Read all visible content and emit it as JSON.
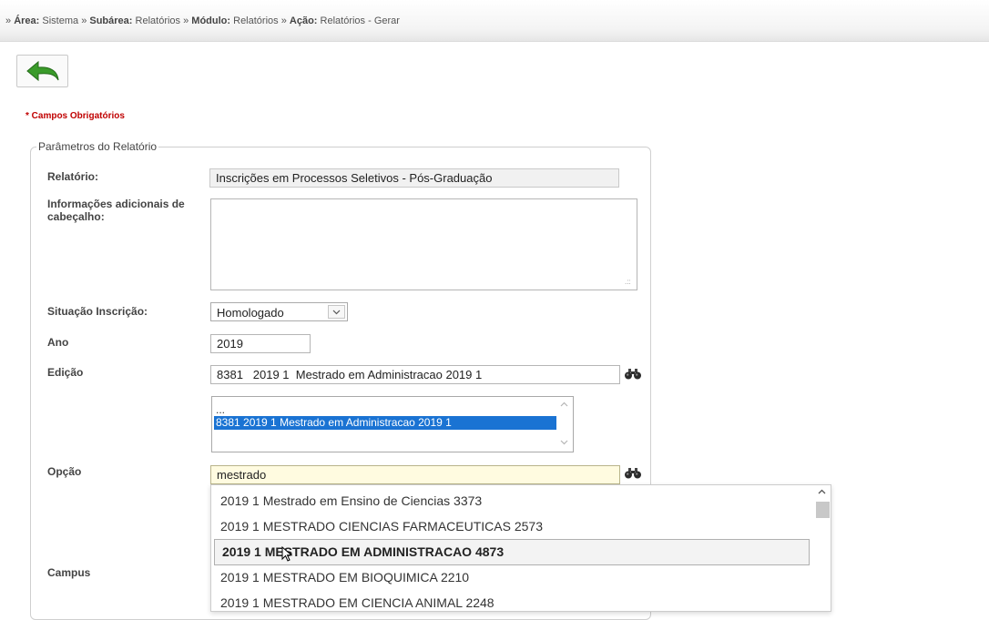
{
  "breadcrumb": {
    "lead": "»",
    "area_label": "Área:",
    "area_value": "Sistema",
    "sep1": "»",
    "subarea_label": "Subárea:",
    "subarea_value": "Relatórios",
    "sep2": "»",
    "modulo_label": "Módulo:",
    "modulo_value": "Relatórios",
    "sep3": "»",
    "acao_label": "Ação:",
    "acao_value": "Relatórios - Gerar"
  },
  "required_note": "* Campos Obrigatórios",
  "fieldset": {
    "legend": "Parâmetros do Relatório"
  },
  "form": {
    "relatorio_label": "Relatório:",
    "relatorio_value": "Inscrições em Processos Seletivos - Pós-Graduação",
    "info_label": "Informações adicionais de cabeçalho:",
    "info_value": "",
    "situacao_label": "Situação Inscrição:",
    "situacao_value": "Homologado",
    "ano_label": "Ano",
    "ano_value": "2019",
    "edicao_label": "Edição",
    "edicao_value": "8381   2019 1  Mestrado em Administracao 2019 1",
    "edicao_list": [
      "...",
      "8381 2019 1 Mestrado em Administracao 2019 1"
    ],
    "opcao_label": "Opção",
    "opcao_value": "mestrado",
    "campus_label": "Campus"
  },
  "autocomplete": {
    "items": [
      "2019 1 Mestrado em Ensino de Ciencias 3373",
      "2019 1 MESTRADO CIENCIAS FARMACEUTICAS 2573",
      "2019 1 MESTRADO EM ADMINISTRACAO 4873",
      "2019 1 MESTRADO EM BIOQUIMICA 2210",
      "2019 1 MESTRADO EM CIENCIA ANIMAL 2248"
    ],
    "active_index": 2
  },
  "colors": {
    "required": "#c00000",
    "selection": "#1a73d3",
    "back_arrow": "#3a9b2a",
    "opcao_bg": "#fffbe0"
  },
  "icons": {
    "back": "undo-arrow-icon",
    "search": "binoculars-icon",
    "dropdown": "chevron-down-icon"
  }
}
